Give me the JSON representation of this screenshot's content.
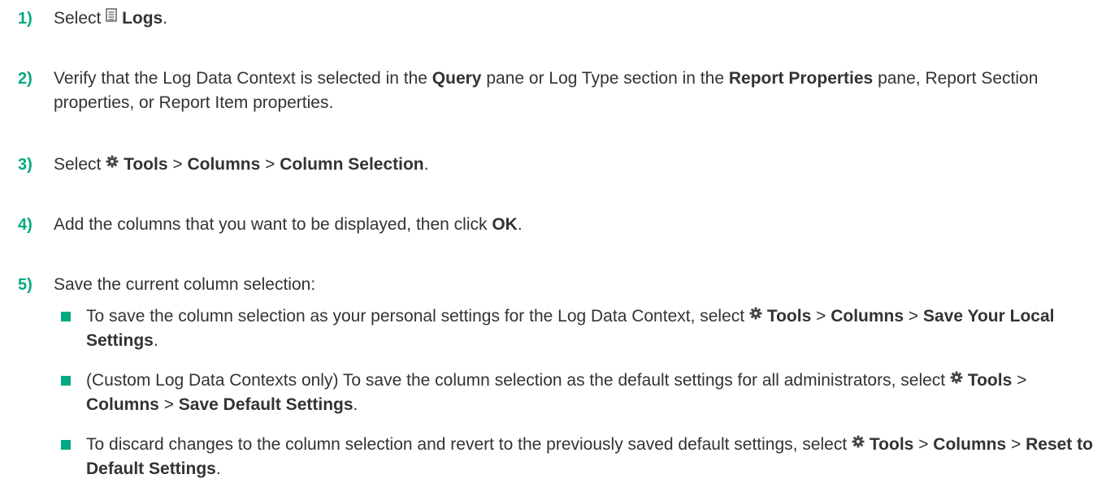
{
  "steps": [
    {
      "number": "1)",
      "parts": [
        "Select",
        "Logs",
        "."
      ]
    },
    {
      "number": "2)",
      "parts": [
        "Verify that the Log Data Context is selected in the",
        "Query",
        "pane or Log Type section in the",
        "Report Properties",
        "pane, Report Section properties, or Report Item properties."
      ]
    },
    {
      "number": "3)",
      "parts": [
        "Select",
        "Tools",
        ">",
        "Columns",
        ">",
        "Column Selection",
        "."
      ]
    },
    {
      "number": "4)",
      "parts": [
        "Add the columns that you want to be displayed, then click",
        "OK",
        "."
      ]
    },
    {
      "number": "5)",
      "parts": [
        "Save the current column selection:"
      ]
    }
  ],
  "bullets": [
    {
      "parts": [
        "To save the column selection as your personal settings for the Log Data Context, select",
        "Tools",
        ">",
        "Columns",
        ">",
        "Save Your Local Settings",
        "."
      ]
    },
    {
      "parts": [
        "(Custom Log Data Contexts only) To save the column selection as the default settings for all administrators, select",
        "Tools",
        ">",
        "Columns",
        ">",
        "Save Default Settings",
        "."
      ]
    },
    {
      "parts": [
        "To discard changes to the column selection and revert to the previously saved default settings, select",
        "Tools",
        ">",
        "Columns",
        ">",
        "Reset to Default Settings",
        "."
      ]
    }
  ],
  "icons": {
    "logs": "document-lines-icon",
    "tools": "gear-icon"
  },
  "colors": {
    "step_number": "#01a982",
    "bullet": "#01a982",
    "text": "#333333"
  }
}
